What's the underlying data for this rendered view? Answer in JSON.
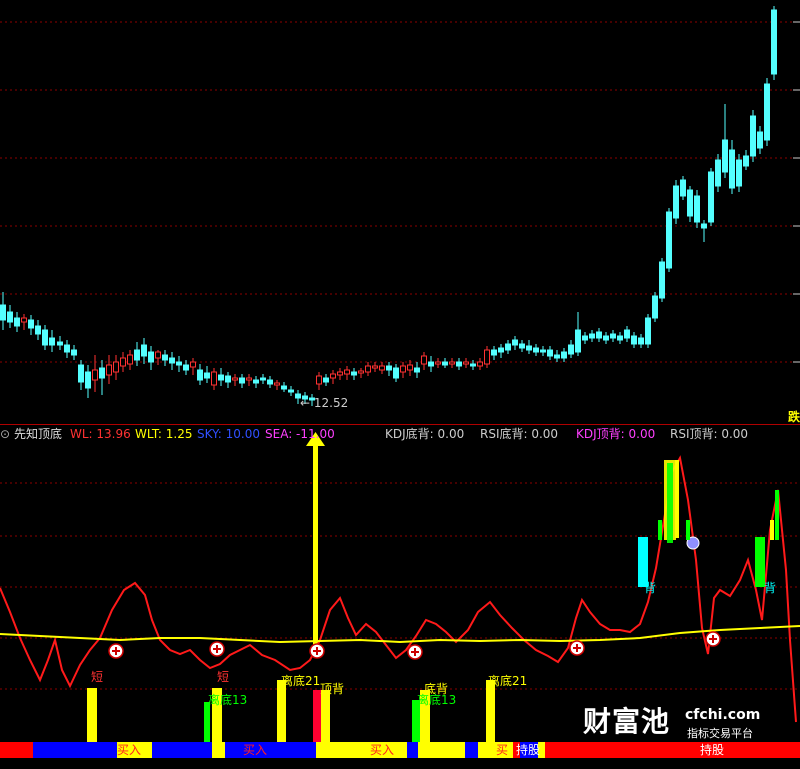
{
  "price_panel": {
    "low_marker": "12.52",
    "edge_label": "跌"
  },
  "indicator": {
    "name": "先知顶底",
    "wl": "WL: 13.96",
    "wlt": "WLT: 1.25",
    "sky": "SKY: 10.00",
    "sea": "SEA: -11.00",
    "kdj_bottom": "KDJ底背: 0.00",
    "rsi_bottom": "RSI底背: 0.00",
    "kdj_top": "KDJ顶背: 0.00",
    "rsi_top": "RSI顶背: 0.00"
  },
  "signals": {
    "short1": "短",
    "short2": "短",
    "div13a": "离底13",
    "div21a": "离底21",
    "back1": "顶背",
    "back2": "底背",
    "div13b": "离底13",
    "div21b": "离底21",
    "back3": "背",
    "back4": "背"
  },
  "status_bar": {
    "buy1": "买入",
    "buy2": "买入",
    "buy3": "买入",
    "buy4": "买",
    "hold1": "持股",
    "hold2": "持股"
  },
  "watermark": {
    "brand": "财富池",
    "domain": "cfchi.com",
    "slogan": "指标交易平台"
  },
  "colors": {
    "up": "#ff3232",
    "down": "#54ffff",
    "wlt_line": "#ffff00",
    "buy_bar": "#ffff00",
    "divergence": "#00ff00",
    "grid": "#8b0000"
  }
}
